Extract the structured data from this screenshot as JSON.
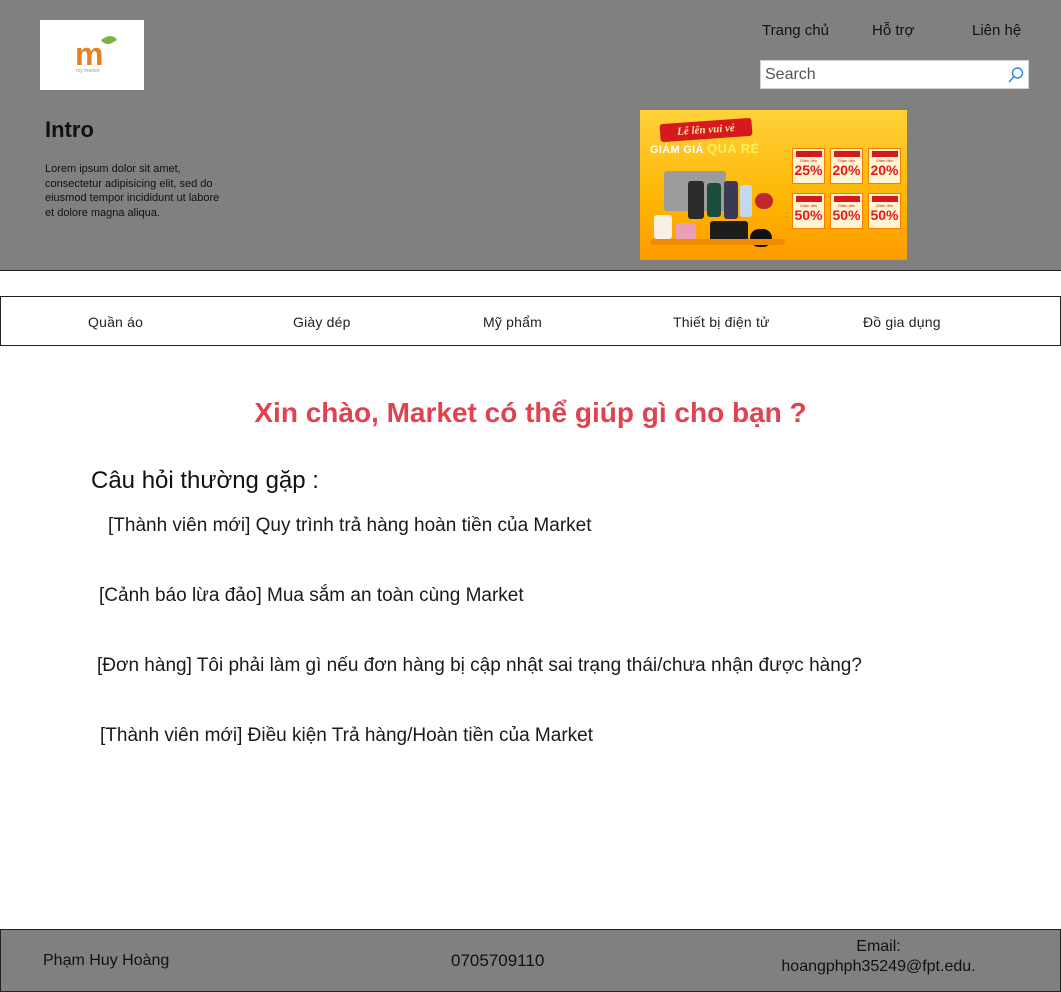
{
  "header": {
    "logo": {
      "mark": "m",
      "subtitle": "my market"
    },
    "links": [
      "Trang chủ",
      "Hỗ trợ",
      "Liên hệ"
    ],
    "search": {
      "placeholder": "Search",
      "value": ""
    },
    "intro": {
      "title": "Intro",
      "text": "Lorem ipsum dolor sit amet, consectetur adipisicing elit, sed do eiusmod tempor incididunt ut labore et dolore magna aliqua."
    }
  },
  "banner": {
    "ribbon": "Lễ lên vui vẻ",
    "headline_prefix": "GIÁM GIÁ",
    "headline_emphasis": "QUÁ RẺ",
    "coupons": [
      "25%",
      "20%",
      "20%",
      "50%",
      "50%",
      "50%"
    ],
    "coupon_label": "Giảm đến"
  },
  "categories": [
    "Quần áo",
    "Giày dép",
    "Mỹ phẩm",
    "Thiết bị điện tử",
    "Đồ gia dụng"
  ],
  "main": {
    "greeting": "Xin chào, Market có thể giúp gì cho bạn ?",
    "faq_title": "Câu hỏi thường gặp :",
    "faq": [
      "[Thành viên mới] Quy trình trả hàng hoàn tiền của Market",
      "[Cảnh báo lừa đảo] Mua sắm an toàn cùng Market",
      "[Đơn hàng] Tôi phải làm gì nếu đơn hàng bị cập nhật sai trạng thái/chưa nhận được hàng?",
      "[Thành viên mới] Điều kiện Trả hàng/Hoàn tiền của Market"
    ]
  },
  "footer": {
    "name": "Phạm Huy  Hoàng",
    "phone": "0705709110",
    "email_label": "Email:",
    "email": "hoangphph35249@fpt.edu."
  },
  "colors": {
    "header_bg": "#808080",
    "greeting": "#e0434f",
    "logo_mark": "#e67e22",
    "search_icon": "#1e88e5"
  }
}
